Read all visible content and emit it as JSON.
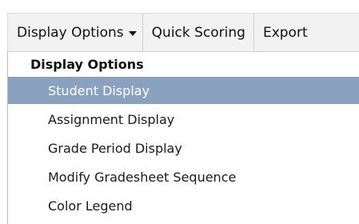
{
  "menubar": {
    "items": [
      {
        "label": "Display Options",
        "icon": "chevron-down-icon"
      },
      {
        "label": "Quick Scoring"
      },
      {
        "label": "Export"
      }
    ]
  },
  "dropdown": {
    "header": "Display Options",
    "items": [
      {
        "label": "Student Display",
        "selected": true
      },
      {
        "label": "Assignment Display"
      },
      {
        "label": "Grade Period Display"
      },
      {
        "label": "Modify Gradesheet Sequence"
      },
      {
        "label": "Color Legend"
      }
    ]
  },
  "colors": {
    "menubar_bg": "#f2f2f2",
    "selected_bg": "#8aa2c0",
    "selected_text": "#ffffff"
  }
}
